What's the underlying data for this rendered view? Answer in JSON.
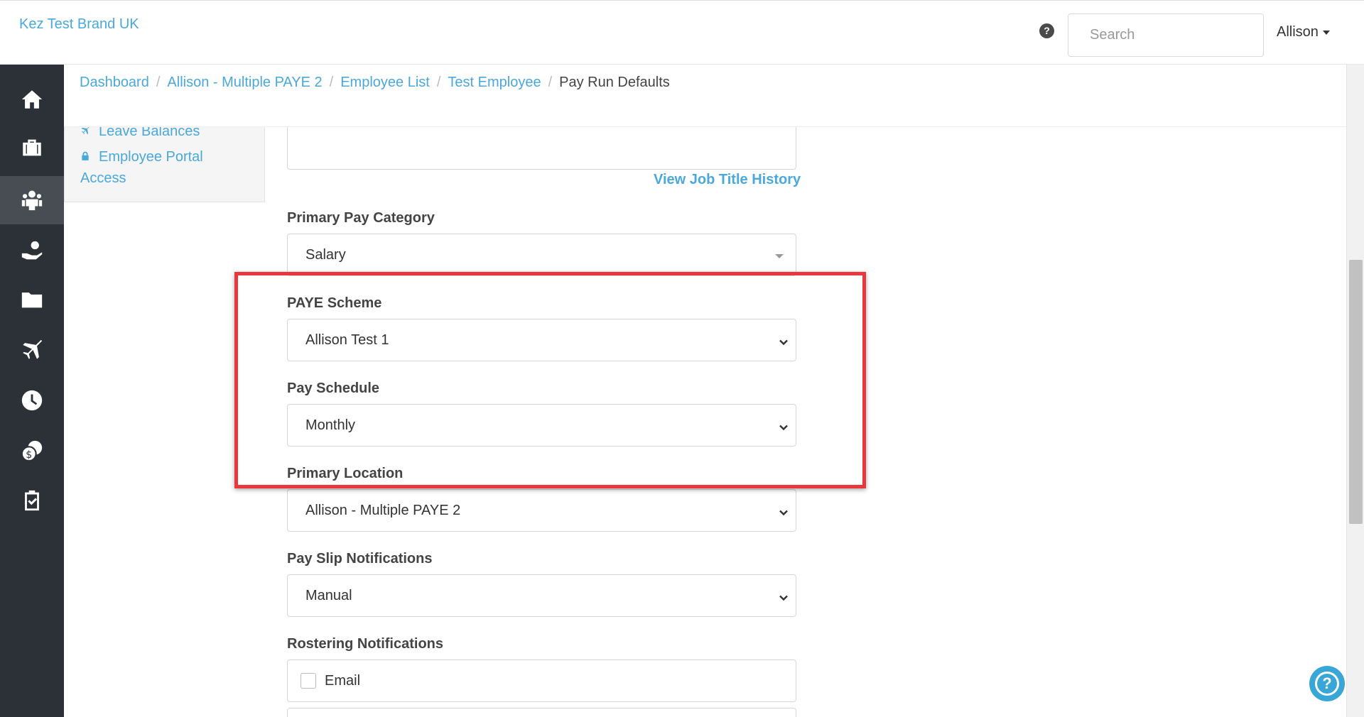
{
  "header": {
    "brand": "Kez Test Brand UK",
    "search_placeholder": "Search",
    "user_name": "Allison"
  },
  "sidebar": {
    "items": [
      {
        "icon": "home-icon",
        "active": false
      },
      {
        "icon": "briefcase-icon",
        "active": false
      },
      {
        "icon": "people-icon",
        "active": true
      },
      {
        "icon": "hand-coin-icon",
        "active": false
      },
      {
        "icon": "folder-icon",
        "active": false
      },
      {
        "icon": "plane-icon",
        "active": false
      },
      {
        "icon": "clock-icon",
        "active": false
      },
      {
        "icon": "coins-icon",
        "active": false
      },
      {
        "icon": "clipboard-check-icon",
        "active": false
      }
    ]
  },
  "breadcrumb": {
    "items": [
      "Dashboard",
      "Allison - Multiple PAYE 2",
      "Employee List",
      "Test Employee"
    ],
    "current": "Pay Run Defaults"
  },
  "subnav": {
    "leave_balances": "Leave Balances",
    "portal_access_line1": "Employee Portal",
    "portal_access_line2": "Access"
  },
  "form": {
    "view_job_title_history": "View Job Title History",
    "primary_pay_category": {
      "label": "Primary Pay Category",
      "value": "Salary"
    },
    "paye_scheme": {
      "label": "PAYE Scheme",
      "value": "Allison Test 1"
    },
    "pay_schedule": {
      "label": "Pay Schedule",
      "value": "Monthly"
    },
    "primary_location": {
      "label": "Primary Location",
      "value": "Allison - Multiple PAYE 2"
    },
    "pay_slip_notifications": {
      "label": "Pay Slip Notifications",
      "value": "Manual"
    },
    "rostering_notifications": {
      "label": "Rostering Notifications",
      "email_label": "Email"
    }
  },
  "colors": {
    "accent": "#4aa8dc",
    "sidebar_bg": "#2b3137",
    "highlight": "#e8383e"
  }
}
